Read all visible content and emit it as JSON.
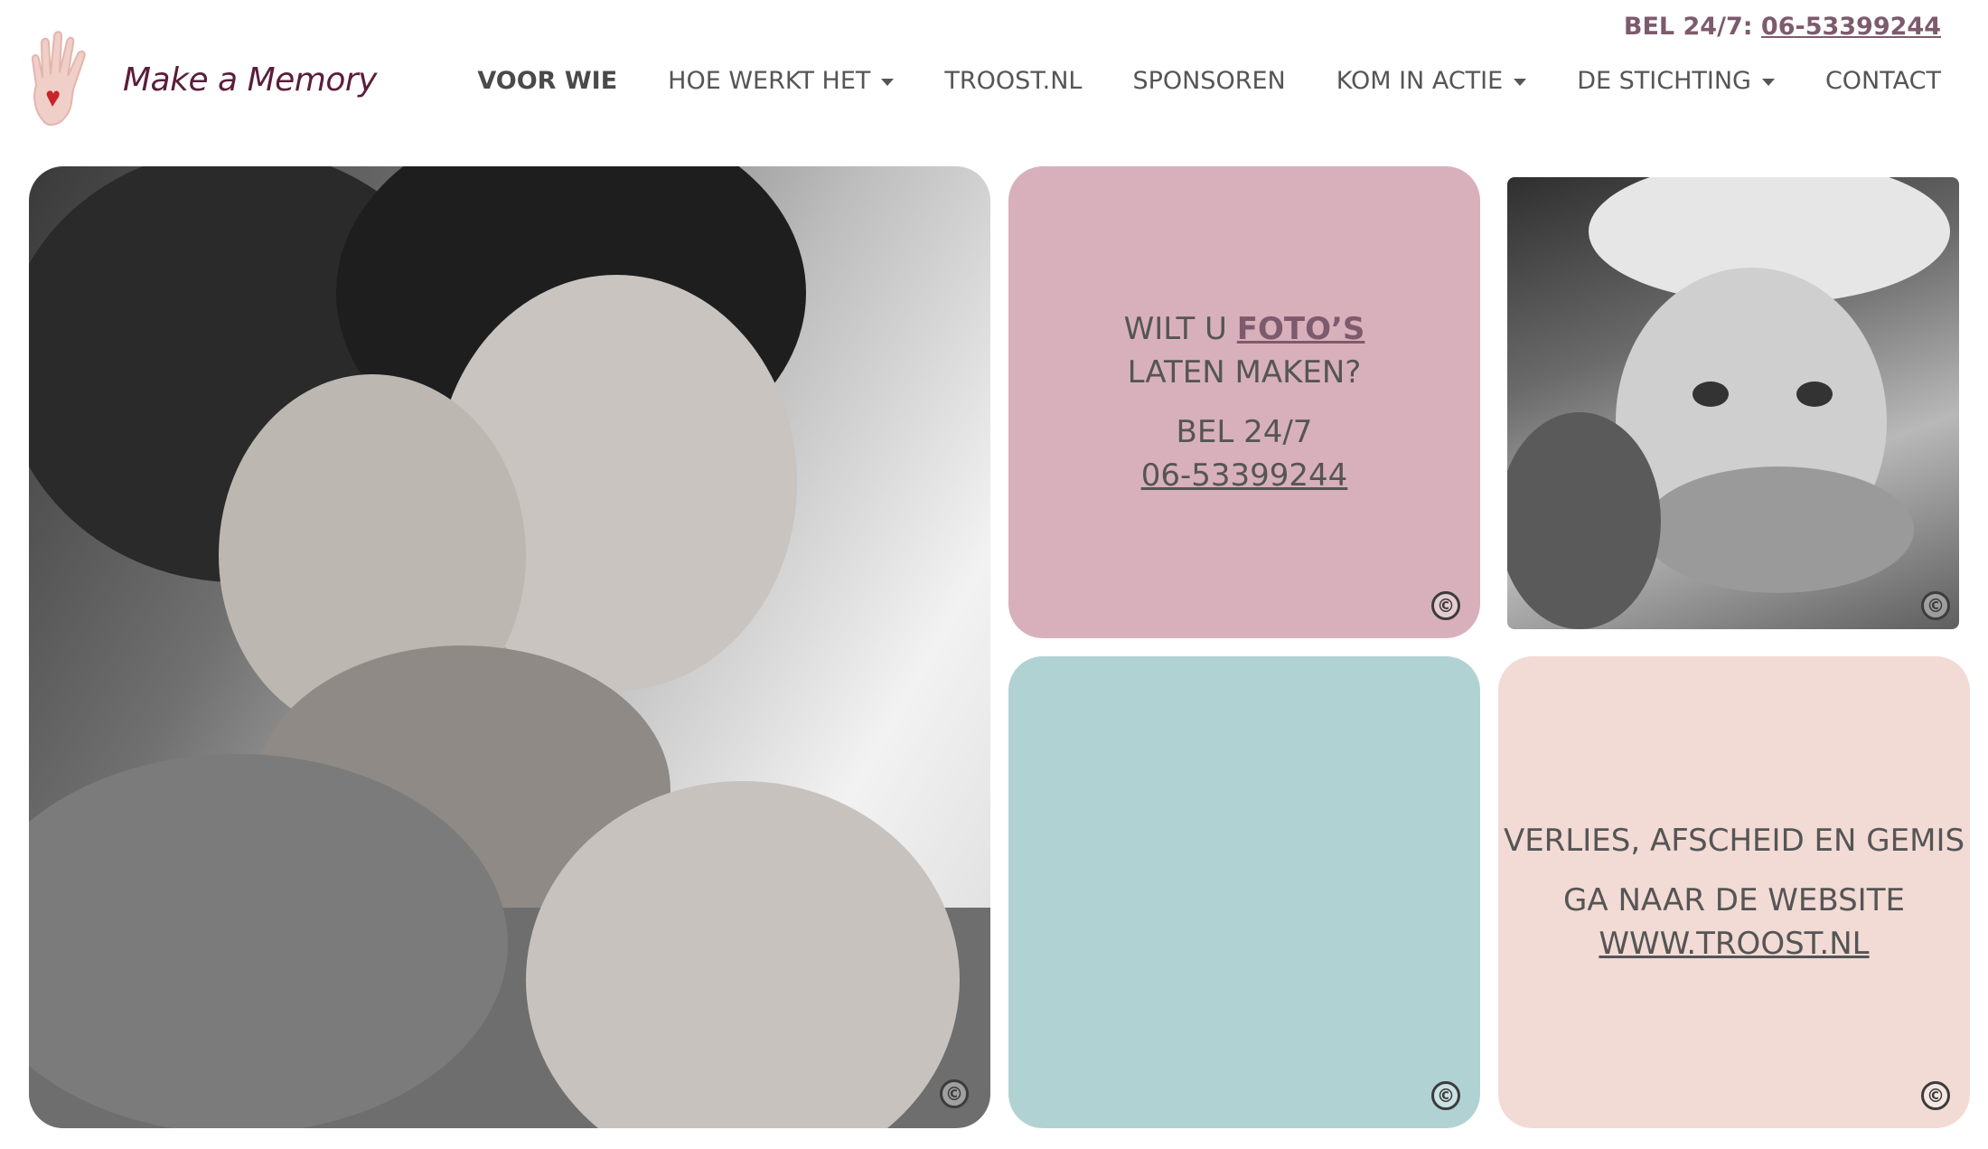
{
  "topbar": {
    "prefix": "BEL 24/7: ",
    "phone": "06-53399244"
  },
  "logo": {
    "text": "Make a Memory"
  },
  "nav": {
    "items": [
      {
        "label": "VOOR WIE",
        "active": true,
        "dropdown": false
      },
      {
        "label": "HOE WERKT HET",
        "active": false,
        "dropdown": true
      },
      {
        "label": "TROOST.NL",
        "active": false,
        "dropdown": false
      },
      {
        "label": "SPONSOREN",
        "active": false,
        "dropdown": false
      },
      {
        "label": "KOM IN ACTIE",
        "active": false,
        "dropdown": true
      },
      {
        "label": "DE STICHTING",
        "active": false,
        "dropdown": true
      },
      {
        "label": "CONTACT",
        "active": false,
        "dropdown": false
      }
    ]
  },
  "tiles": {
    "pink": {
      "line1_prefix": "WILT U ",
      "line1_link": "FOTO’S",
      "line2": "LATEN MAKEN?",
      "line3": "BEL 24/7",
      "phone": "06-53399244",
      "copyright": "©"
    },
    "teal": {
      "copyright": "©"
    },
    "blush": {
      "line1": "VERLIES, AFSCHEID EN GEMIS",
      "line2": "GA NAAR DE WEBSITE",
      "link": "WWW.TROOST.NL",
      "copyright": "©"
    },
    "photo_main": {
      "copyright": "©"
    },
    "photo_small": {
      "copyright": "©"
    }
  },
  "colors": {
    "brand": "#5b1d3c",
    "accent_link": "#7d5a6c",
    "pink_tile": "#d8b0bb",
    "teal_tile": "#b0d2d3",
    "blush_tile": "#f2dad5"
  }
}
